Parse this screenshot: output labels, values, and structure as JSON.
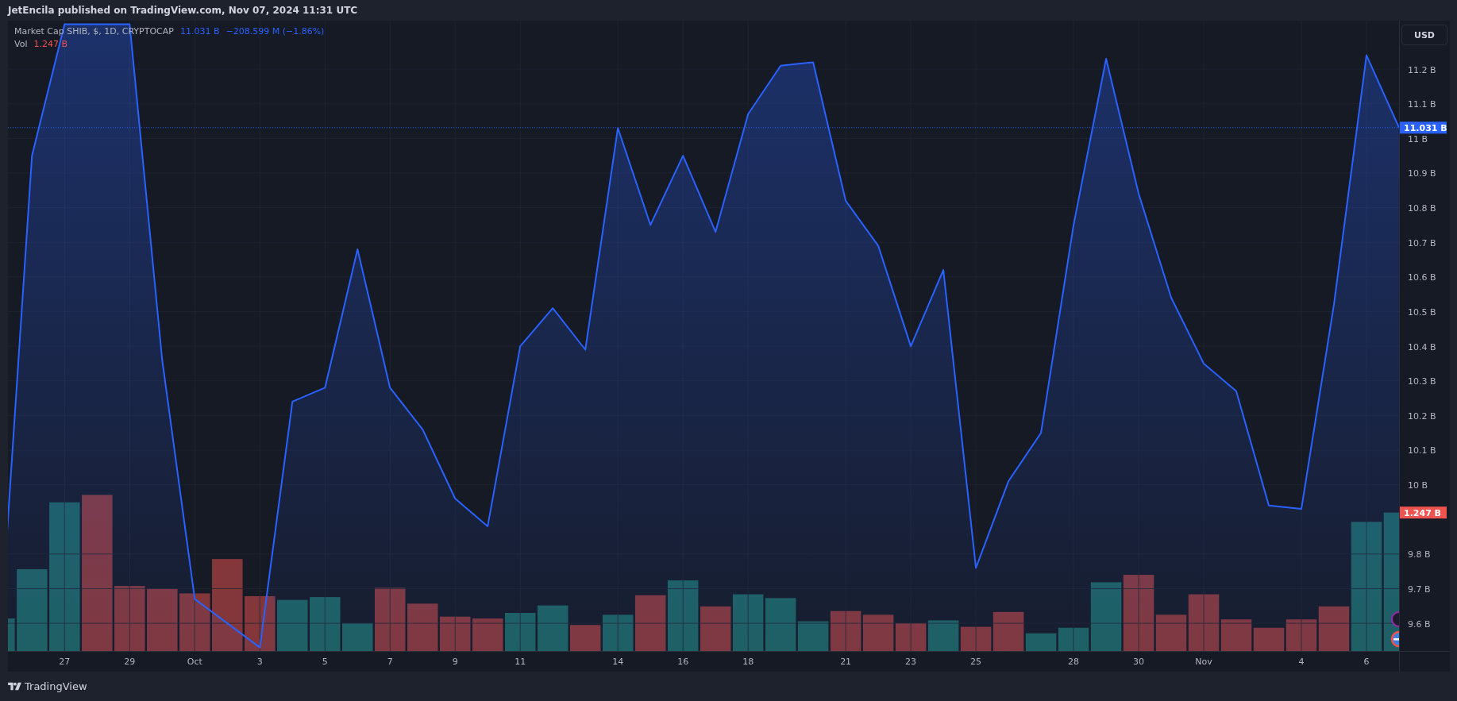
{
  "header": {
    "text": "JetEncila published on TradingView.com, Nov 07, 2024 11:31 UTC"
  },
  "legend": {
    "title": "Market Cap SHIB, $, 1D, CRYPTOCAP",
    "value": "11.031 B",
    "change": "−208.599 M (−1.86%)",
    "volume_label": "Vol",
    "volume_value": "1.247 B"
  },
  "price_axis": {
    "currency_button": "USD",
    "last_price_label": "11.031 B",
    "last_volume_label": "1.247 B"
  },
  "chart_data": {
    "type": "area",
    "grid": true,
    "categories": [
      null,
      null,
      "27",
      null,
      "29",
      null,
      "Oct",
      null,
      "3",
      null,
      "5",
      null,
      "7",
      null,
      "9",
      null,
      "11",
      null,
      null,
      "14",
      null,
      "16",
      null,
      "18",
      null,
      null,
      "21",
      null,
      "23",
      null,
      "25",
      null,
      null,
      "28",
      null,
      "30",
      null,
      "Nov",
      null,
      null,
      "4",
      null,
      "6",
      null
    ],
    "series": [
      {
        "color": "#2962ff",
        "values": [
          9.53,
          10.95,
          11.33,
          11.33,
          11.33,
          10.36,
          9.67,
          9.6,
          9.53,
          10.24,
          10.28,
          10.68,
          10.28,
          10.16,
          9.96,
          9.88,
          10.4,
          10.51,
          10.39,
          11.03,
          10.75,
          10.95,
          10.73,
          11.07,
          11.21,
          11.22,
          10.82,
          10.69,
          10.4,
          10.62,
          9.76,
          10.01,
          10.15,
          10.75,
          11.23,
          10.84,
          10.54,
          10.35,
          10.27,
          9.94,
          9.93,
          10.52,
          11.24,
          11.031
        ]
      }
    ],
    "ylim": [
      9.52,
      11.34
    ],
    "yticks": [
      {
        "value": 9.6,
        "label": "9.6 B"
      },
      {
        "value": 9.7,
        "label": "9.7 B"
      },
      {
        "value": 9.8,
        "label": "9.8 B"
      },
      {
        "value": 10,
        "label": "10 B"
      },
      {
        "value": 10.1,
        "label": "10.1 B"
      },
      {
        "value": 10.2,
        "label": "10.2 B"
      },
      {
        "value": 10.3,
        "label": "10.3 B"
      },
      {
        "value": 10.4,
        "label": "10.4 B"
      },
      {
        "value": 10.5,
        "label": "10.5 B"
      },
      {
        "value": 10.6,
        "label": "10.6 B"
      },
      {
        "value": 10.7,
        "label": "10.7 B"
      },
      {
        "value": 10.8,
        "label": "10.8 B"
      },
      {
        "value": 10.9,
        "label": "10.9 B"
      },
      {
        "value": 11,
        "label": "11 B"
      },
      {
        "value": 11.1,
        "label": "11.1 B"
      },
      {
        "value": 11.2,
        "label": "11.2 B"
      }
    ]
  },
  "footer": {
    "brand": "TradingView"
  }
}
